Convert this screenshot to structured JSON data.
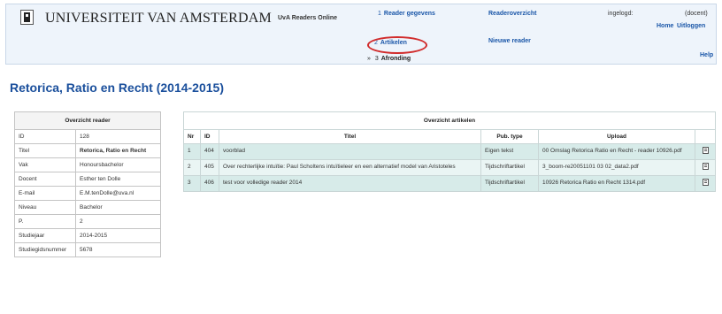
{
  "header": {
    "university": "UNIVERSITEIT VAN AMSTERDAM",
    "app_name": "UvA Readers Online",
    "steps": [
      {
        "num": "1",
        "label": "Reader gegevens"
      },
      {
        "num": "2",
        "label": "Artikelen"
      },
      {
        "num": "3",
        "label": "Afronding"
      }
    ],
    "readeroverzicht": "Readeroverzicht",
    "nieuwe_reader": "Nieuwe reader",
    "ingelogd": "ingelogd:",
    "role": "(docent)",
    "home": "Home",
    "uitloggen": "Uitloggen",
    "help": "Help"
  },
  "page_title": "Retorica, Ratio en Recht (2014-2015)",
  "reader": {
    "caption": "Overzicht reader",
    "rows": [
      {
        "label": "ID",
        "value": "128"
      },
      {
        "label": "Titel",
        "value": "Retorica, Ratio en Recht"
      },
      {
        "label": "Vak",
        "value": "Honoursbachelor"
      },
      {
        "label": "Docent",
        "value": "Esther ten Dolle"
      },
      {
        "label": "E-mail",
        "value": "E.M.tenDolle@uva.nl"
      },
      {
        "label": "Niveau",
        "value": "Bachelor"
      },
      {
        "label": "P.",
        "value": "2"
      },
      {
        "label": "Studiejaar",
        "value": "2014-2015"
      },
      {
        "label": "Studiegidsnummer",
        "value": "5678"
      }
    ]
  },
  "articles": {
    "caption": "Overzicht artikelen",
    "headers": {
      "nr": "Nr",
      "id": "ID",
      "titel": "Titel",
      "type": "Pub. type",
      "upload": "Upload"
    },
    "rows": [
      {
        "nr": "1",
        "id": "404",
        "titel": "voorblad",
        "type": "Eigen tekst",
        "upload": "00 Omslag Retorica Ratio en Recht - reader 10926.pdf"
      },
      {
        "nr": "2",
        "id": "405",
        "titel": "Over rechterlijke intuïtie: Paul Scholtens intuïtieleer en een alternatief model van Aristoteles",
        "type": "Tijdschriftartikel",
        "upload": "3_boom-re20051101 03 02_data2.pdf"
      },
      {
        "nr": "3",
        "id": "406",
        "titel": "test voor volledige reader 2014",
        "type": "Tijdschriftartikel",
        "upload": "10926 Retorica Ratio en Recht 1314.pdf"
      }
    ]
  },
  "colors": {
    "accent": "#1a4f9c",
    "link": "#1a56a8",
    "highlight_circle": "#d12c2c",
    "row_bg": "#d7ebe9",
    "header_bg": "#eef4fb"
  }
}
